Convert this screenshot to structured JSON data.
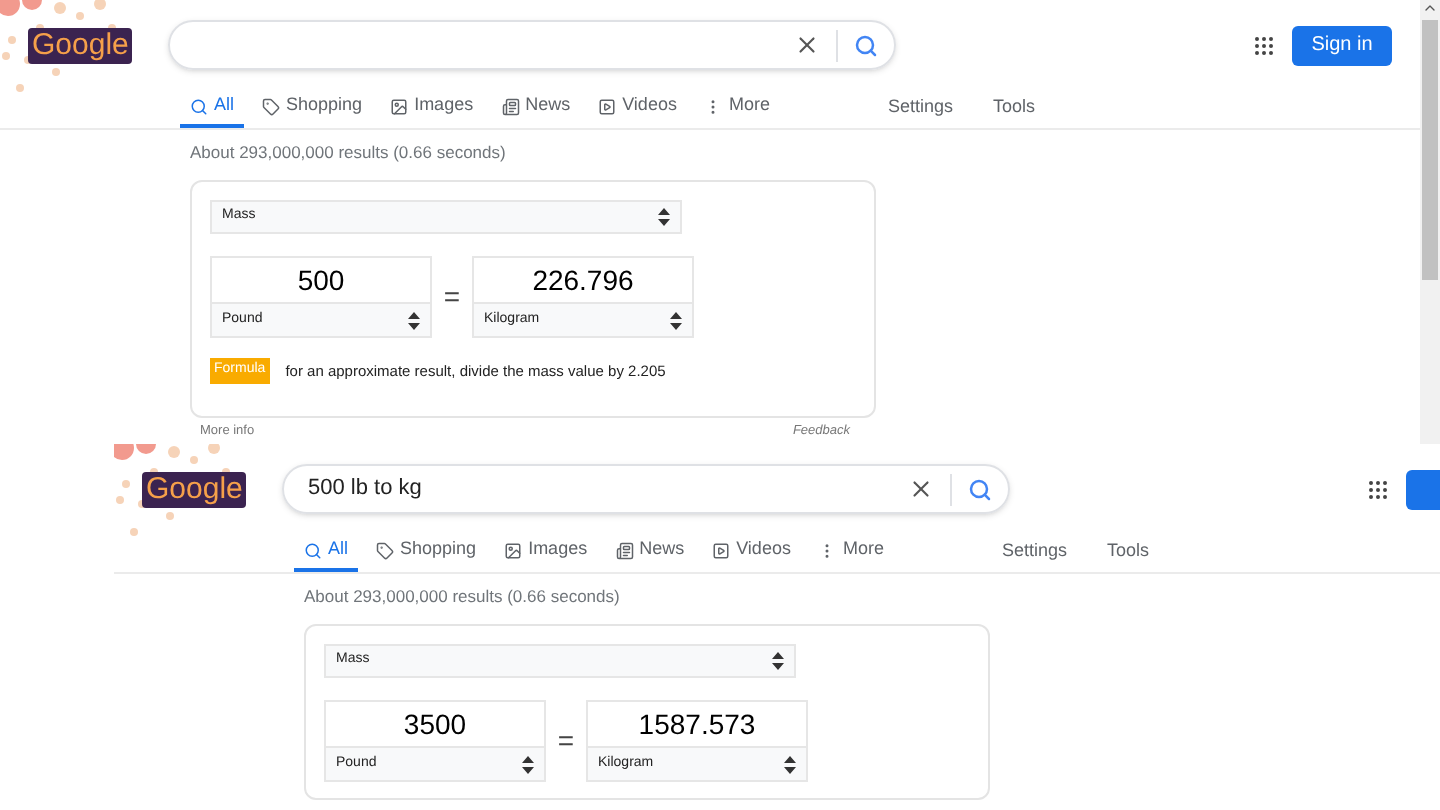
{
  "pages": [
    {
      "logo": "Google",
      "tabs": [
        {
          "label": "All",
          "selected": true
        },
        {
          "label": "Shopping",
          "selected": false
        },
        {
          "label": "Images",
          "selected": false
        },
        {
          "label": "News",
          "selected": false
        },
        {
          "label": "Videos",
          "selected": false
        },
        {
          "label": "More",
          "selected": false
        }
      ],
      "settings": "Settings",
      "tools": "Tools",
      "sign_in": "Sign in",
      "results_stats": "About 293,000,000 results (0.66 seconds)",
      "converter": {
        "quantity": "Mass",
        "from": {
          "value": "500",
          "unit": "Pound"
        },
        "equals": "=",
        "to": {
          "value": "226.796",
          "unit": "Kilogram"
        },
        "formula_badge": "Formula",
        "formula": "for an approximate result, divide the mass value by 2.205"
      },
      "more_info": "More info",
      "feedback": "Feedback"
    },
    {
      "logo": "Google",
      "search": {
        "value": "500 lb to kg"
      },
      "tabs": [
        {
          "label": "All",
          "selected": true
        },
        {
          "label": "Shopping",
          "selected": false
        },
        {
          "label": "Images",
          "selected": false
        },
        {
          "label": "News",
          "selected": false
        },
        {
          "label": "Videos",
          "selected": false
        },
        {
          "label": "More",
          "selected": false
        }
      ],
      "settings": "Settings",
      "tools": "Tools",
      "results_stats": "About 293,000,000 results (0.66 seconds)",
      "converter": {
        "quantity": "Mass",
        "from": {
          "value": "3500",
          "unit": "Pound"
        },
        "equals": "=",
        "to": {
          "value": "1587.573",
          "unit": "Kilogram"
        }
      }
    }
  ]
}
